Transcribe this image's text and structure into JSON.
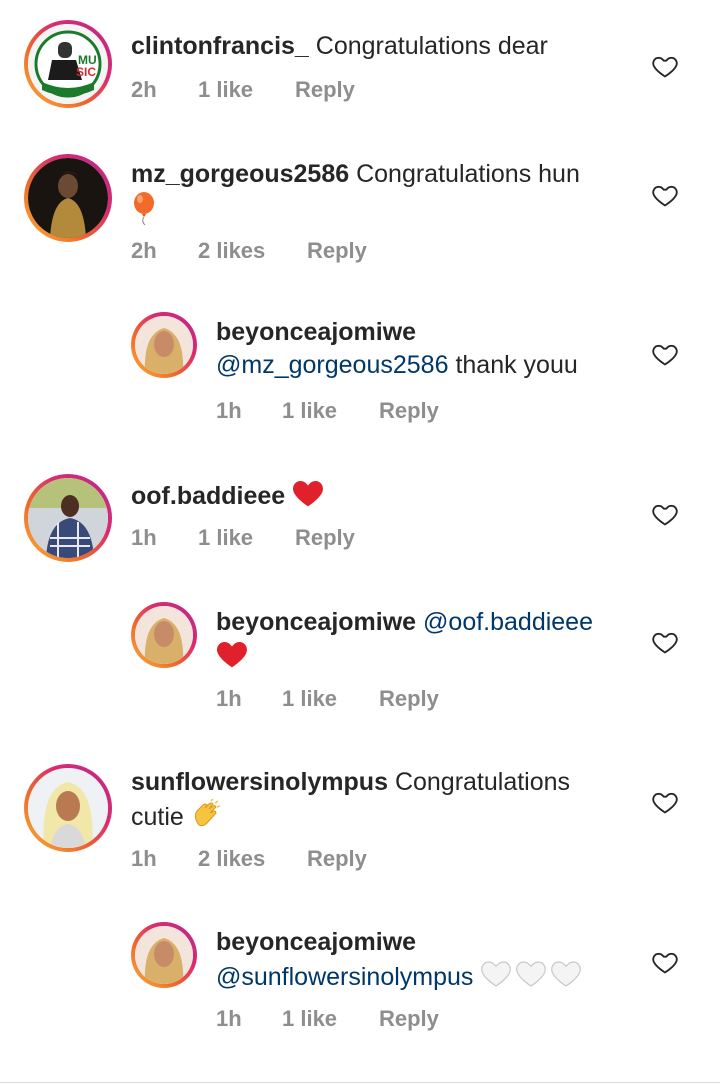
{
  "comments": [
    {
      "username": "clintonfrancis_",
      "text": "Congratulations dear",
      "time": "2h",
      "likes": "1 like",
      "reply": "Reply"
    },
    {
      "username": "mz_gorgeous2586",
      "text": "Congratulations hun",
      "time": "2h",
      "likes": "2 likes",
      "reply": "Reply",
      "emoji": "balloon"
    },
    {
      "username": "beyonceajomiwe",
      "mention": "@mz_gorgeous2586",
      "text": "thank youu",
      "time": "1h",
      "likes": "1 like",
      "reply": "Reply"
    },
    {
      "username": "oof.baddieee",
      "text": "",
      "time": "1h",
      "likes": "1 like",
      "reply": "Reply",
      "emoji": "red-heart"
    },
    {
      "username": "beyonceajomiwe",
      "mention": "@oof.baddieee",
      "text": "",
      "time": "1h",
      "likes": "1 like",
      "reply": "Reply",
      "emoji": "red-heart"
    },
    {
      "username": "sunflowersinolympus",
      "text": "Congratulations",
      "text2": "cutie",
      "time": "1h",
      "likes": "2 likes",
      "reply": "Reply",
      "emoji": "clapping-hands"
    },
    {
      "username": "beyonceajomiwe",
      "mention": "@sunflowersinolympus",
      "text": "",
      "time": "1h",
      "likes": "1 like",
      "reply": "Reply",
      "emoji": "white-hearts"
    }
  ],
  "icons": {
    "like": "heart-outline-icon"
  },
  "colors": {
    "mention": "#00376b",
    "meta": "#8e8e8e",
    "text": "#262626"
  }
}
